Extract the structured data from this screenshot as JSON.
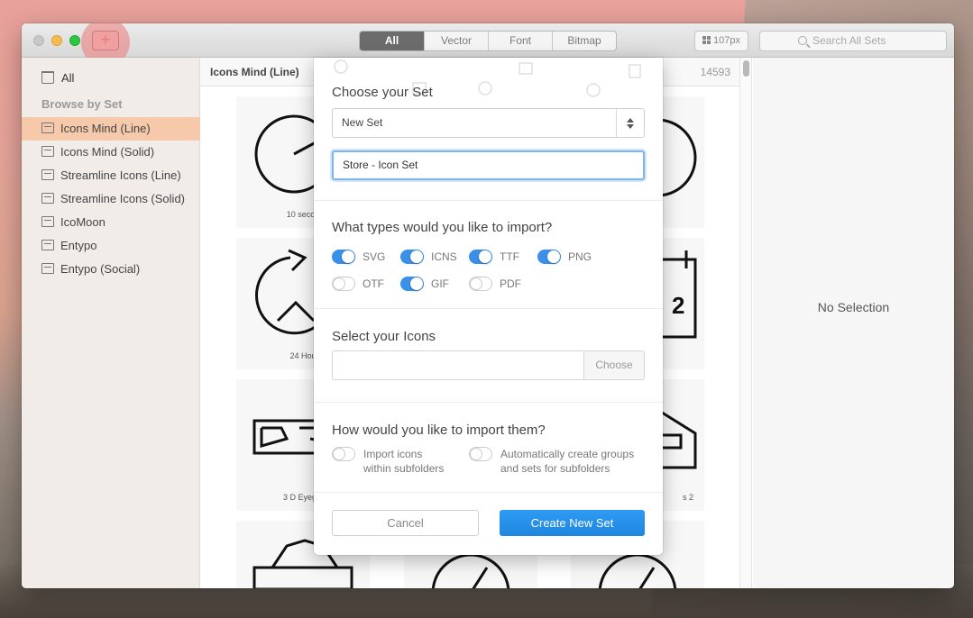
{
  "titlebar": {
    "add_label": "+",
    "filters": [
      {
        "label": "All",
        "active": true
      },
      {
        "label": "Vector",
        "active": false
      },
      {
        "label": "Font",
        "active": false
      },
      {
        "label": "Bitmap",
        "active": false
      }
    ],
    "size_value": "107px",
    "search_placeholder": "Search All Sets"
  },
  "sidebar": {
    "all_label": "All",
    "section_header": "Browse by Set",
    "items": [
      {
        "label": "Icons Mind (Line)",
        "selected": true
      },
      {
        "label": "Icons Mind (Solid)",
        "selected": false
      },
      {
        "label": "Streamline Icons (Line)",
        "selected": false
      },
      {
        "label": "Streamline Icons (Solid)",
        "selected": false
      },
      {
        "label": "IcoMoon",
        "selected": false
      },
      {
        "label": "Entypo",
        "selected": false
      },
      {
        "label": "Entypo (Social)",
        "selected": false
      }
    ]
  },
  "content": {
    "title": "Icons Mind (Line)",
    "count": "14593",
    "tiles": [
      {
        "label": "10 secou"
      },
      {
        "label": "24 Hou"
      },
      {
        "label": "3 D Eyegla"
      },
      {
        "label": "s 2"
      }
    ]
  },
  "inspector": {
    "empty_text": "No Selection"
  },
  "modal": {
    "choose_set_title": "Choose your Set",
    "set_select_value": "New Set",
    "set_name_value": "Store - Icon Set",
    "types_title": "What types would you like to import?",
    "types": [
      {
        "label": "SVG",
        "on": true
      },
      {
        "label": "ICNS",
        "on": true
      },
      {
        "label": "TTF",
        "on": true
      },
      {
        "label": "PNG",
        "on": true
      },
      {
        "label": "OTF",
        "on": false
      },
      {
        "label": "GIF",
        "on": true
      },
      {
        "label": "PDF",
        "on": false
      }
    ],
    "select_icons_title": "Select your Icons",
    "choose_label": "Choose",
    "import_title": "How would you like to import them?",
    "import_opts": [
      {
        "line1": "Import icons",
        "line2": "within subfolders",
        "on": false
      },
      {
        "line1": "Automatically create groups",
        "line2": "and sets for subfolders",
        "on": false
      }
    ],
    "cancel_label": "Cancel",
    "create_label": "Create New Set"
  },
  "colors": {
    "accent": "#2e9bf2",
    "toggle_on": "#3a8fe8",
    "sidebar_selected": "#f5c9a9"
  }
}
